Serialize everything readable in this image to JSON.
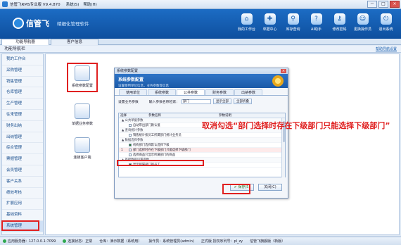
{
  "app": {
    "title": "信管飞RMS专业版 V9.4.870",
    "menu": [
      "系统(S)",
      "帮助(H)"
    ],
    "window_buttons": [
      "－",
      "□",
      "×"
    ]
  },
  "banner": {
    "brand": "信管飞",
    "tagline": "精细化管理软件",
    "tools": [
      {
        "icon": "home-icon",
        "glyph": "⌂",
        "label": "我的工作台"
      },
      {
        "icon": "cart-icon",
        "glyph": "✚",
        "label": "单据中心"
      },
      {
        "icon": "search-icon",
        "glyph": "⚲",
        "label": "库存查询"
      },
      {
        "icon": "help-icon",
        "glyph": "?",
        "label": "AI助手"
      },
      {
        "icon": "key-icon",
        "glyph": "⚷",
        "label": "修改密码"
      },
      {
        "icon": "user-switch-icon",
        "glyph": "☺",
        "label": "更换操作员"
      },
      {
        "icon": "exit-icon",
        "glyph": "⏻",
        "label": "退出系统"
      }
    ]
  },
  "tabs": [
    "功能导航器",
    "客户信息"
  ],
  "nav_header": {
    "title": "功能导航栏",
    "right_link": "帮助导航设置"
  },
  "sidebar": {
    "items": [
      "我的工作台",
      "采购管理",
      "销售管理",
      "仓库管理",
      "生产管理",
      "往来管理",
      "财务出纳",
      "出纳管理",
      "综合管理",
      "票据管理",
      "会员管理",
      "客户关系",
      "绩效考核",
      "扩展应用",
      "基础资料",
      "系统管理"
    ],
    "active_index": 15
  },
  "main_icons": [
    {
      "label": "系统参数配置",
      "icon": "database-settings-icon"
    },
    {
      "label": "单据业务参数",
      "icon": "form-settings-icon"
    },
    {
      "label": "连锁客户端",
      "icon": "network-icon"
    }
  ],
  "dialog": {
    "title": "系统参数配置",
    "close": "×",
    "header_title": "系统参数配置",
    "header_subtitle": "设置使用单位信息，业务参数等信息",
    "tabs": [
      "使用单位",
      "系统参数",
      "公共参数",
      "财务参数",
      "出纳参数"
    ],
    "active_tab": 2,
    "search_label": "设置业务参数",
    "search_hint": "输入参数名称检索：",
    "search_value": "部门",
    "btn_show_all": "显示全部",
    "btn_select_all": "全部折叠",
    "grid_headers": [
      "选择",
      "参数名称",
      "参数说明"
    ],
    "rows": [
      {
        "type": "group",
        "text": "▲ 公共单据参数"
      },
      {
        "type": "item",
        "checked": false,
        "text": "自动带出部门默认值"
      },
      {
        "type": "group",
        "text": "▲ 查询统计参数"
      },
      {
        "type": "item",
        "checked": false,
        "text": "销售统计按员工所属部门统计业务员"
      },
      {
        "type": "group",
        "text": "▲ 数据选择参数"
      },
      {
        "type": "item",
        "checked": true,
        "text": "机构部门选择默认选择下级"
      },
      {
        "type": "selected",
        "index": "1",
        "checked": false,
        "text": "部门选择时存在下级部门只能选择下级部门"
      },
      {
        "type": "item",
        "checked": false,
        "text": "选择商品只显示所属部门的商品"
      },
      {
        "type": "group",
        "text": "▲ 基础数据设置参数"
      },
      {
        "type": "item",
        "checked": true,
        "text": "显示所属部门的员工"
      }
    ],
    "btn_save": "✔ 保存(S)",
    "btn_close": "关闭(C)"
  },
  "annotation": "取消勾选“部门选择时存在下级部门只能选择下级部门”",
  "status": {
    "server": "应用服务器：127.0.0.1:7099",
    "conn": "连接状态：正常",
    "store": "仓库：演示数据（系统用）",
    "operator": "操作员：系统管理员(admin)",
    "version": "正式版  授权序列号：pl_zy",
    "company": "信管飞旗舰版（新版）"
  }
}
